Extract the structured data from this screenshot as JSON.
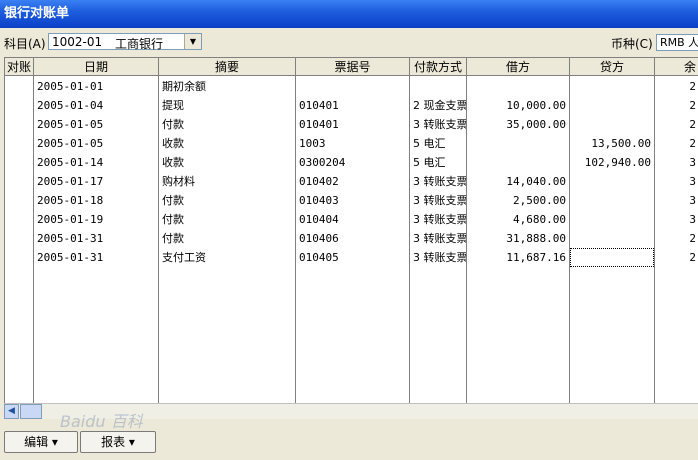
{
  "window": {
    "title": "银行对账单"
  },
  "toolbar": {
    "account_label": "科目(A)",
    "account_code": "1002-01",
    "account_name": "工商银行",
    "currency_label": "币种(C)",
    "currency_value": "RMB 人"
  },
  "grid": {
    "headers": [
      "对账",
      "日期",
      "摘要",
      "票据号",
      "付款方式",
      "借方",
      "贷方",
      "余"
    ],
    "rows": [
      {
        "reconciled": "",
        "date": "2005-01-01",
        "summary": "期初余额",
        "voucher": "",
        "payment": "",
        "debit": "",
        "credit": "",
        "balance": "2"
      },
      {
        "reconciled": "",
        "date": "2005-01-04",
        "summary": "提现",
        "voucher": "010401",
        "payment": "2 现金支票",
        "debit": "10,000.00",
        "credit": "",
        "balance": "2"
      },
      {
        "reconciled": "",
        "date": "2005-01-05",
        "summary": "付款",
        "voucher": "010401",
        "payment": "3 转账支票",
        "debit": "35,000.00",
        "credit": "",
        "balance": "2"
      },
      {
        "reconciled": "",
        "date": "2005-01-05",
        "summary": "收款",
        "voucher": "1003",
        "payment": "5 电汇",
        "debit": "",
        "credit": "13,500.00",
        "balance": "2"
      },
      {
        "reconciled": "",
        "date": "2005-01-14",
        "summary": "收款",
        "voucher": "0300204",
        "payment": "5 电汇",
        "debit": "",
        "credit": "102,940.00",
        "balance": "3"
      },
      {
        "reconciled": "",
        "date": "2005-01-17",
        "summary": "购材料",
        "voucher": "010402",
        "payment": "3 转账支票",
        "debit": "14,040.00",
        "credit": "",
        "balance": "3"
      },
      {
        "reconciled": "",
        "date": "2005-01-18",
        "summary": "付款",
        "voucher": "010403",
        "payment": "3 转账支票",
        "debit": "2,500.00",
        "credit": "",
        "balance": "3"
      },
      {
        "reconciled": "",
        "date": "2005-01-19",
        "summary": "付款",
        "voucher": "010404",
        "payment": "3 转账支票",
        "debit": "4,680.00",
        "credit": "",
        "balance": "3"
      },
      {
        "reconciled": "",
        "date": "2005-01-31",
        "summary": "付款",
        "voucher": "010406",
        "payment": "3 转账支票",
        "debit": "31,888.00",
        "credit": "",
        "balance": "2"
      },
      {
        "reconciled": "",
        "date": "2005-01-31",
        "summary": "支付工资",
        "voucher": "010405",
        "payment": "3 转账支票",
        "debit": "11,687.16",
        "credit": "",
        "balance": "2"
      }
    ]
  },
  "buttons": {
    "edit": "编辑 ▾",
    "report": "报表 ▾"
  },
  "watermark": "Baidu 百科",
  "colors": {
    "titlebar": "#0a3fc8",
    "background": "#ece9d8",
    "grid_bg": "#ffffff"
  }
}
